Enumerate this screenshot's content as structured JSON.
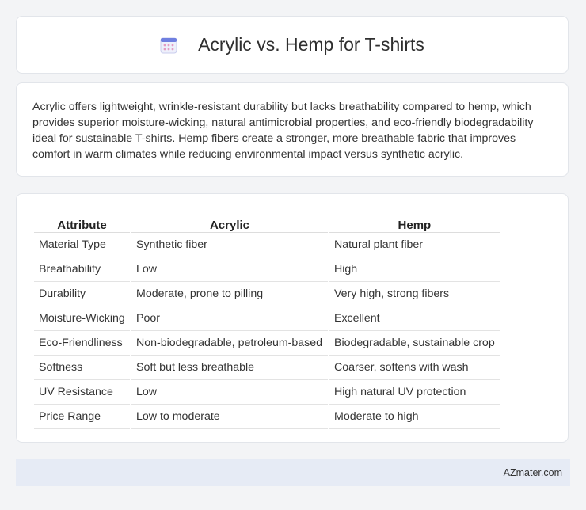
{
  "header": {
    "title": "Acrylic vs. Hemp for T-shirts",
    "icon": "calendar-icon"
  },
  "summary": {
    "text": "Acrylic offers lightweight, wrinkle-resistant durability but lacks breathability compared to hemp, which provides superior moisture-wicking, natural antimicrobial properties, and eco-friendly biodegradability ideal for sustainable T-shirts. Hemp fibers create a stronger, more breathable fabric that improves comfort in warm climates while reducing environmental impact versus synthetic acrylic."
  },
  "table": {
    "headers": [
      "Attribute",
      "Acrylic",
      "Hemp"
    ],
    "rows": [
      [
        "Material Type",
        "Synthetic fiber",
        "Natural plant fiber"
      ],
      [
        "Breathability",
        "Low",
        "High"
      ],
      [
        "Durability",
        "Moderate, prone to pilling",
        "Very high, strong fibers"
      ],
      [
        "Moisture-Wicking",
        "Poor",
        "Excellent"
      ],
      [
        "Eco-Friendliness",
        "Non-biodegradable, petroleum-based",
        "Biodegradable, sustainable crop"
      ],
      [
        "Softness",
        "Soft but less breathable",
        "Coarser, softens with wash"
      ],
      [
        "UV Resistance",
        "Low",
        "High natural UV protection"
      ],
      [
        "Price Range",
        "Low to moderate",
        "Moderate to high"
      ]
    ]
  },
  "footer": {
    "text": "AZmater.com"
  }
}
